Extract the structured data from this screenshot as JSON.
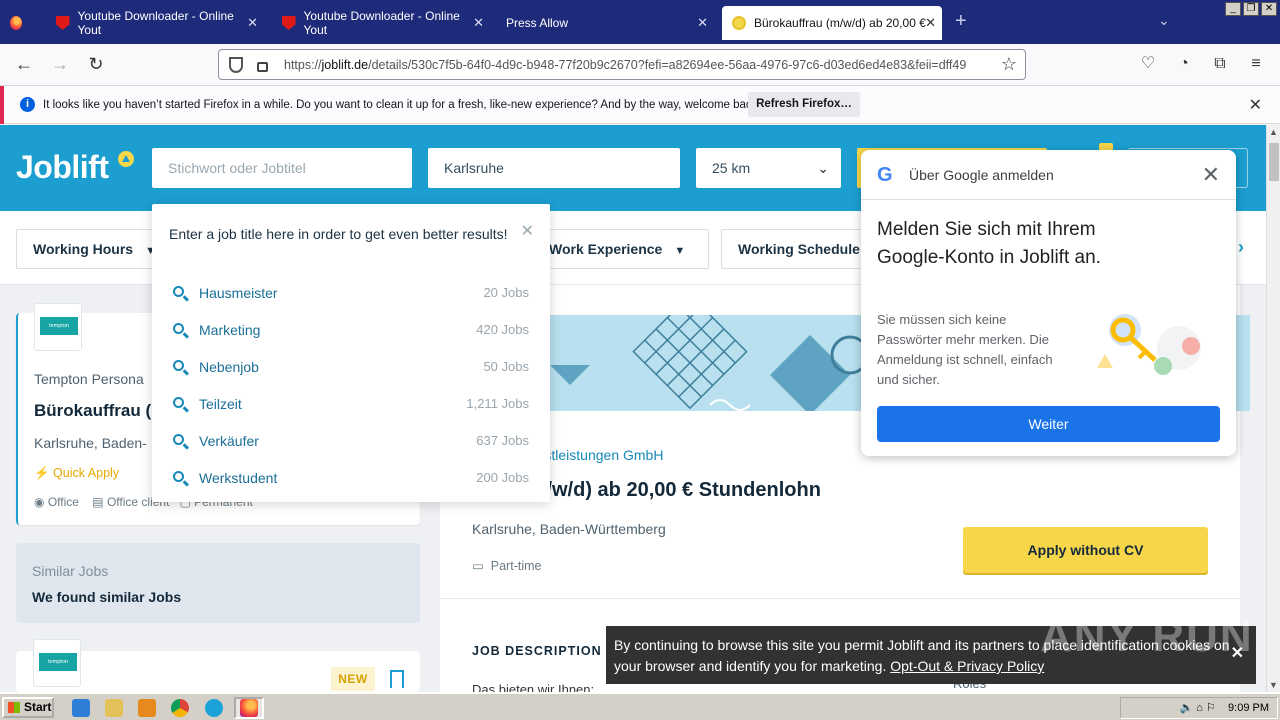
{
  "browser": {
    "tabs": [
      {
        "title": "Youtube Downloader - Online Yout",
        "icon": "youtube-download-icon"
      },
      {
        "title": "Youtube Downloader - Online Yout",
        "icon": "youtube-download-icon"
      },
      {
        "title": "Press Allow",
        "icon": ""
      },
      {
        "title": "Bürokauffrau (m/w/d) ab 20,00 €",
        "icon": "joblift-favicon"
      }
    ],
    "url_prefix": "https://",
    "url_host": "joblift.de",
    "url_path": "/details/530c7f5b-64f0-4d9c-b948-77f20b9c2670?fefi=a82694ee-56aa-4976-97c6-d03ed6ed4e83&feii=dff49",
    "infobar_message": "It looks like you haven’t started Firefox in a while. Do you want to clean it up for a fresh, like-new experience? And by the way, welcome back!",
    "infobar_button": "Refresh Firefox…"
  },
  "header": {
    "logo": "Joblift",
    "search_placeholder": "Stichwort oder Jobtitel",
    "location_value": "Karlsruhe",
    "radius_value": "25 km"
  },
  "filters": [
    {
      "label": "Working Hours"
    },
    {
      "label": "Work Experience"
    },
    {
      "label": "Working Schedule"
    }
  ],
  "suggestions": {
    "hint": "Enter a job title here in order to get even better results!",
    "items": [
      {
        "name": "Hausmeister",
        "count": "20 Jobs"
      },
      {
        "name": "Marketing",
        "count": "420 Jobs"
      },
      {
        "name": "Nebenjob",
        "count": "50 Jobs"
      },
      {
        "name": "Teilzeit",
        "count": "1,211 Jobs"
      },
      {
        "name": "Verkäufer",
        "count": "637 Jobs"
      },
      {
        "name": "Werkstudent",
        "count": "200 Jobs"
      }
    ]
  },
  "job_card": {
    "logo_text": "tempton",
    "company": "Tempton Persona",
    "title": "Bürokauffrau (m",
    "location": "Karlsruhe, Baden-",
    "quick_apply": "Quick Apply",
    "meta_office": "Office",
    "meta_office_client": "Office client",
    "meta_permanent": "Permanent"
  },
  "similar": {
    "label": "Similar Jobs",
    "text": "We found similar Jobs"
  },
  "card2": {
    "logo_text": "tempton",
    "badge": "NEW"
  },
  "detail": {
    "company": "ersonaldienstleistungen GmbH",
    "title": "ffrau (m/w/d) ab 20,00 € Stundenlohn",
    "location": "Karlsruhe, Baden-Württemberg",
    "type": "Part-time",
    "apply_button": "Apply without CV",
    "job_description_heading": "JOB DESCRIPTION",
    "desc_line": "Das bieten wir Ihnen:",
    "roles": "Roles"
  },
  "google_popup": {
    "header": "Über Google anmelden",
    "title": "Melden Sie sich mit Ihrem Google-Konto in Joblift an.",
    "body": "Sie müssen sich keine Passwörter mehr merken. Die Anmeldung ist schnell, einfach und sicher.",
    "button": "Weiter"
  },
  "cookie": {
    "text": "By continuing to browse this site you permit Joblift and its partners to place identification cookies on your browser and identify you for marketing.",
    "link": "Opt-Out & Privacy Policy"
  },
  "watermark": "ANY RUN",
  "taskbar": {
    "start": "Start",
    "clock": "9:09 PM"
  },
  "colors": {
    "brand_blue": "#1c9fd0",
    "brand_yellow": "#f7d64a",
    "google_blue": "#1a73e8",
    "firefox_tabbar": "#1e2a7a"
  }
}
